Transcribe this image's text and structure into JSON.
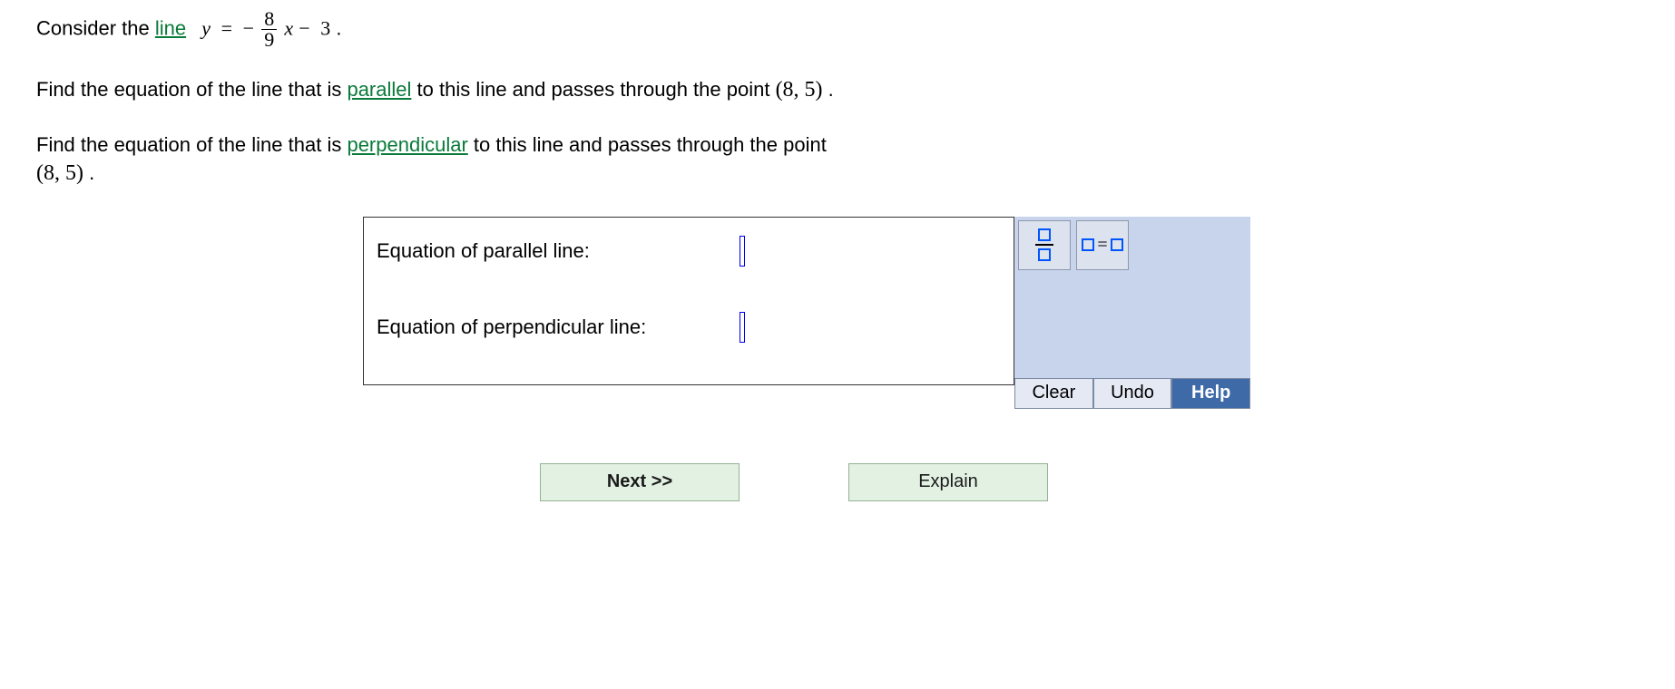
{
  "problem": {
    "intro_prefix": "Consider the ",
    "link_line": "line",
    "equation": {
      "lhs": "y",
      "eq": "=",
      "neg": "−",
      "frac_num": "8",
      "frac_den": "9",
      "var": "x",
      "minus": "−",
      "const": "3",
      "period": "."
    },
    "parallel_prefix": "Find the equation of the line that is ",
    "link_parallel": "parallel",
    "parallel_suffix": " to this line and passes through the point ",
    "point1": "(8, 5)",
    "period1": ".",
    "perp_prefix": "Find the equation of the line that is ",
    "link_perpendicular": "perpendicular",
    "perp_suffix": " to this line and passes through the point",
    "point2": "(8, 5)",
    "period2": "."
  },
  "answers": {
    "parallel_label": "Equation of parallel line:",
    "perpendicular_label": "Equation of perpendicular line:"
  },
  "tools": {
    "fraction_name": "fraction",
    "equation_name": "equation",
    "eq_symbol": "=",
    "clear": "Clear",
    "undo": "Undo",
    "help": "Help"
  },
  "nav": {
    "next": "Next >>",
    "explain": "Explain"
  }
}
